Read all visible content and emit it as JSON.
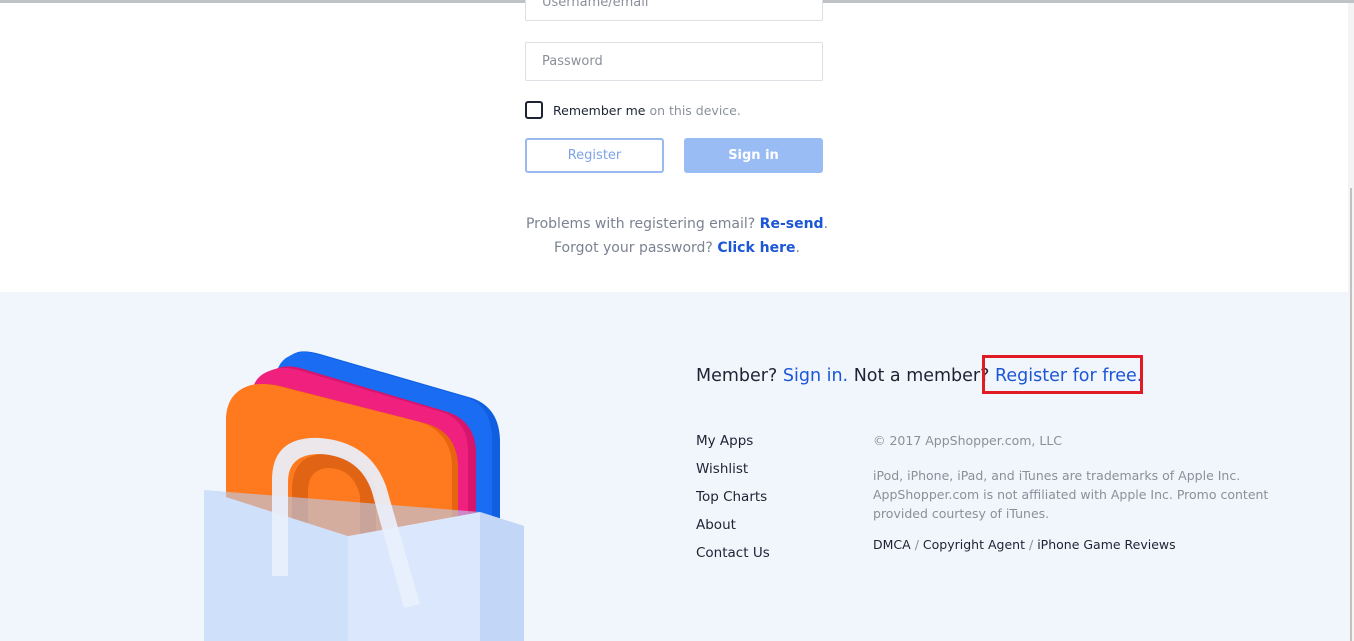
{
  "login": {
    "username_placeholder": "Username/email",
    "password_placeholder": "Password",
    "remember_label": "Remember me",
    "remember_suffix": "on this device.",
    "register_button": "Register",
    "signin_button": "Sign in",
    "problems_text": "Problems with registering email?",
    "resend_link": "Re-send",
    "forgot_text": "Forgot your password?",
    "click_here_link": "Click here",
    "period": "."
  },
  "footer": {
    "member_text": "Member?",
    "sign_in_link": "Sign in.",
    "not_member_text": "Not a member?",
    "register_link": "Register for free.",
    "nav": [
      "My Apps",
      "Wishlist",
      "Top Charts",
      "About",
      "Contact Us"
    ],
    "copyright": "© 2017 AppShopper.com, LLC",
    "legal": "iPod, iPhone, iPad, and iTunes are trademarks of Apple Inc. AppShopper.com is not affiliated with Apple Inc. Promo content provided courtesy of iTunes.",
    "links": [
      "DMCA",
      "Copyright Agent",
      "iPhone Game Reviews"
    ],
    "link_separator": "/"
  },
  "colors": {
    "accent": "#1a56d6",
    "footer_bg": "#f1f5fc",
    "highlight": "#e01b24"
  }
}
